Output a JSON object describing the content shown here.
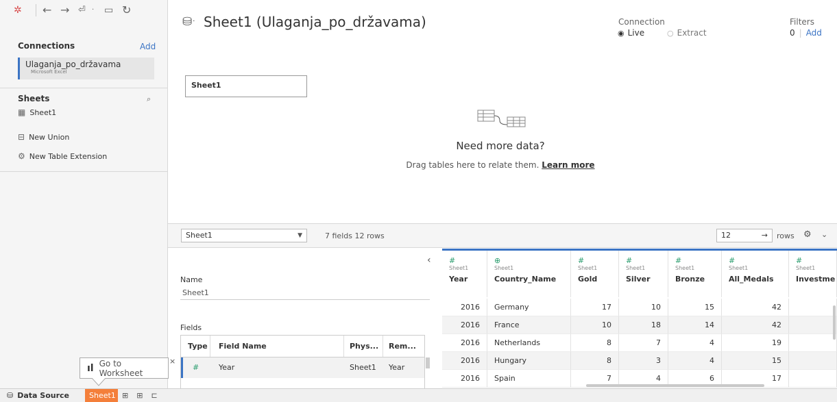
{
  "app": {
    "connections_label": "Connections",
    "add_label": "Add",
    "connection": {
      "name": "Ulaganja_po_državama",
      "type": "Microsoft Excel"
    },
    "sheets_label": "Sheets",
    "sheets": [
      "Sheet1"
    ],
    "new_union": "New Union",
    "new_table_extension": "New Table Extension"
  },
  "header": {
    "title": "Sheet1 (Ulaganja_po_državama)",
    "connection_label": "Connection",
    "live_label": "Live",
    "extract_label": "Extract",
    "filters_label": "Filters",
    "filters_count": "0",
    "filters_add": "Add"
  },
  "canvas": {
    "table_box": "Sheet1",
    "need_more": "Need more data?",
    "drag_text": "Drag tables here to relate them.",
    "learn_more": "Learn more"
  },
  "toolbar": {
    "table_select": "Sheet1",
    "fields_rows": "7 fields 12 rows",
    "rows_value": "12",
    "rows_label": "rows"
  },
  "details": {
    "name_label": "Name",
    "name_value": "Sheet1",
    "fields_label": "Fields",
    "columns": [
      "Type",
      "Field Name",
      "Phys...",
      "Rem..."
    ],
    "row": {
      "type": "#",
      "field": "Year",
      "phys": "Sheet1",
      "rem": "Year"
    }
  },
  "tooltip": {
    "go_to_worksheet": "Go to Worksheet"
  },
  "grid": {
    "columns": [
      {
        "type": "#",
        "src": "Sheet1",
        "name": "Year"
      },
      {
        "type": "⊕",
        "src": "Sheet1",
        "name": "Country_Name"
      },
      {
        "type": "#",
        "src": "Sheet1",
        "name": "Gold"
      },
      {
        "type": "#",
        "src": "Sheet1",
        "name": "Silver"
      },
      {
        "type": "#",
        "src": "Sheet1",
        "name": "Bronze"
      },
      {
        "type": "#",
        "src": "Sheet1",
        "name": "All_Medals"
      },
      {
        "type": "#",
        "src": "Sheet1",
        "name": "Investme"
      }
    ],
    "rows": [
      [
        "2016",
        "Germany",
        "17",
        "10",
        "15",
        "42"
      ],
      [
        "2016",
        "France",
        "10",
        "18",
        "14",
        "42"
      ],
      [
        "2016",
        "Netherlands",
        "8",
        "7",
        "4",
        "19"
      ],
      [
        "2016",
        "Hungary",
        "8",
        "3",
        "4",
        "15"
      ],
      [
        "2016",
        "Spain",
        "7",
        "4",
        "6",
        "17"
      ]
    ]
  },
  "bottom": {
    "data_source": "Data Source",
    "sheet_tab": "Sheet1"
  },
  "colors": {
    "accent": "#3b74c4",
    "tab_active": "#f47f3a",
    "measure": "#2a9d6e"
  }
}
